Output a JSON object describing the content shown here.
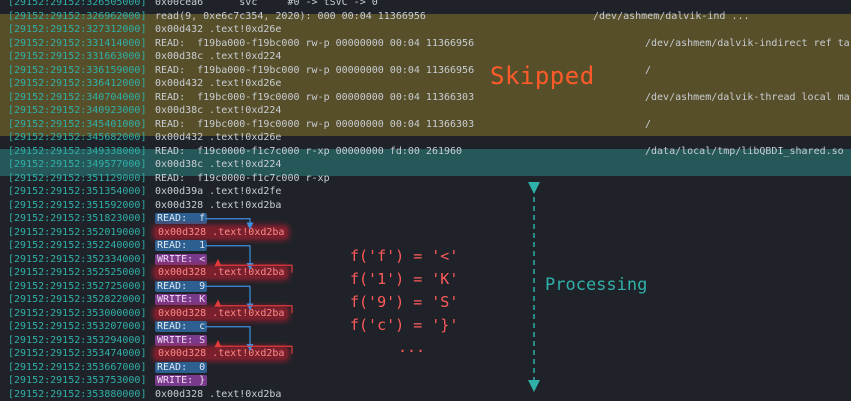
{
  "lines": [
    {
      "ts": "[29152:29152:326505000]",
      "text": "0x00cea6      svc     #0 -> tSVC -> 0"
    },
    {
      "ts": "[29152:29152:326962000]",
      "text": "read(9, 0xe6c7c354, 2020): 000 00:04 11366956",
      "path": "/dev/ashmem/dalvik-ind ..."
    },
    {
      "ts": "[29152:29152:327312000]",
      "text": "0x00d432 .text!0xd26e"
    },
    {
      "ts": "[29152:29152:331414000]",
      "text": "READ:  f19ba000-f19bc000 rw-p 00000000 00:04 11366956",
      "path": "/dev/ashmem/dalvik-indirect ref ta"
    },
    {
      "ts": "[29152:29152:331663000]",
      "text": "0x00d38c .text!0xd224"
    },
    {
      "ts": "[29152:29152:336159000]",
      "text": "READ:  f19ba000-f19bc000 rw-p 00000000 00:04 11366956",
      "path": "/"
    },
    {
      "ts": "[29152:29152:336412000]",
      "text": "0x00d432 .text!0xd26e"
    },
    {
      "ts": "[29152:29152:340704000]",
      "text": "READ:  f19bc000-f19c0000 rw-p 00000000 00:04 11366303",
      "path": "/dev/ashmem/dalvik-thread local ma"
    },
    {
      "ts": "[29152:29152:340923000]",
      "text": "0x00d38c .text!0xd224"
    },
    {
      "ts": "[29152:29152:345401000]",
      "text": "READ:  f19bc000-f19c0000 rw-p 00000000 00:04 11366303",
      "path": "/"
    },
    {
      "ts": "[29152:29152:345682000]",
      "text": "0x00d432 .text!0xd26e"
    },
    {
      "ts": "[29152:29152:349338000]",
      "text": "READ:  f19c0000-f1c7c000 r-xp 00000000 fd:00 261960",
      "path": "/data/local/tmp/libQBDI_shared.so"
    },
    {
      "ts": "[29152:29152:349577000]",
      "text": "0x00d38c .text!0xd224"
    },
    {
      "ts": "[29152:29152:351129000]",
      "text": "READ:  f19c0000-f1c7c000 r-xp"
    },
    {
      "ts": "[29152:29152:351354000]",
      "text": "0x00d39a .text!0xd2fe"
    },
    {
      "ts": "[29152:29152:351592000]",
      "text": "0x00d328 .text!0xd2ba"
    },
    {
      "ts": "[29152:29152:351823000]",
      "hl": "blue",
      "text": "READ:  f"
    },
    {
      "ts": "[29152:29152:352019000]",
      "hl": "red",
      "text": "0x00d328 .text!0xd2ba"
    },
    {
      "ts": "[29152:29152:352240000]",
      "hl": "blue",
      "text": "READ:  1"
    },
    {
      "ts": "[29152:29152:352334000]",
      "hl": "purple",
      "text": "WRITE: <"
    },
    {
      "ts": "[29152:29152:352525000]",
      "hl": "red",
      "text": "0x00d328 .text!0xd2ba"
    },
    {
      "ts": "[29152:29152:352725000]",
      "hl": "blue",
      "text": "READ:  9"
    },
    {
      "ts": "[29152:29152:352822000]",
      "hl": "purple",
      "text": "WRITE: K"
    },
    {
      "ts": "[29152:29152:353000000]",
      "hl": "red",
      "text": "0x00d328 .text!0xd2ba"
    },
    {
      "ts": "[29152:29152:353207000]",
      "hl": "blue",
      "text": "READ:  c"
    },
    {
      "ts": "[29152:29152:353294000]",
      "hl": "purple",
      "text": "WRITE: S"
    },
    {
      "ts": "[29152:29152:353474000]",
      "hl": "red",
      "text": "0x00d328 .text!0xd2ba"
    },
    {
      "ts": "[29152:29152:353667000]",
      "hl": "blue",
      "text": "READ:  0"
    },
    {
      "ts": "[29152:29152:353753000]",
      "hl": "purple",
      "text": "WRITE: }"
    },
    {
      "ts": "[29152:29152:353880000]",
      "text": "0x00d328 .text!0xd2ba"
    }
  ],
  "annotations": {
    "skipped": "Skipped",
    "processing": "Processing",
    "mapping": [
      "f('f') = '<'",
      "f('1') = 'K'",
      "f('9') = 'S'",
      "f('c') = '}'",
      "..."
    ]
  },
  "colors": {
    "timestamp": "#2fb0a8",
    "skipped_band": "#6b5f2a",
    "lib_band": "#2a6e6e",
    "read_hl": "#2d5f90",
    "write_hl": "#7a3a8c",
    "addr_hl": "#7a1f2c",
    "annotation_red": "#ff5a5a",
    "skipped_text": "#ff5a2a"
  }
}
